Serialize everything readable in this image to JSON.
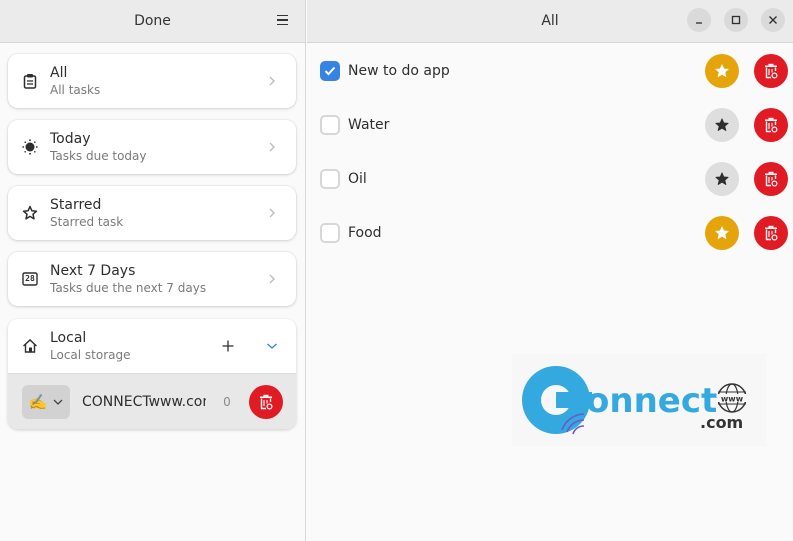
{
  "sidebar": {
    "title": "Done",
    "menu_icon": "hamburger-menu-icon",
    "items": [
      {
        "title": "All",
        "subtitle": "All tasks",
        "icon": "clipboard-icon"
      },
      {
        "title": "Today",
        "subtitle": "Tasks due today",
        "icon": "sun-icon"
      },
      {
        "title": "Starred",
        "subtitle": "Starred task",
        "icon": "star-icon"
      },
      {
        "title": "Next 7 Days",
        "subtitle": "Tasks due the next 7 days",
        "icon": "calendar-icon"
      }
    ],
    "calendar_number": "28",
    "service": {
      "title": "Local",
      "subtitle": "Local storage",
      "lists": [
        {
          "emoji": "✍️",
          "name": "CONNECTwww.com",
          "count": "0"
        }
      ]
    }
  },
  "main": {
    "title": "All",
    "tasks": [
      {
        "text": "New to do app",
        "done": true,
        "starred": true
      },
      {
        "text": "Water",
        "done": false,
        "starred": false
      },
      {
        "text": "Oil",
        "done": false,
        "starred": false
      },
      {
        "text": "Food",
        "done": false,
        "starred": true
      }
    ]
  },
  "watermark": {
    "brand": "onnect",
    "suffix": ".com",
    "globe_text": "www"
  },
  "colors": {
    "accent": "#3584e4",
    "star": "#e5a50a",
    "destructive": "#e01b24",
    "watermark": "#34a9e0"
  }
}
